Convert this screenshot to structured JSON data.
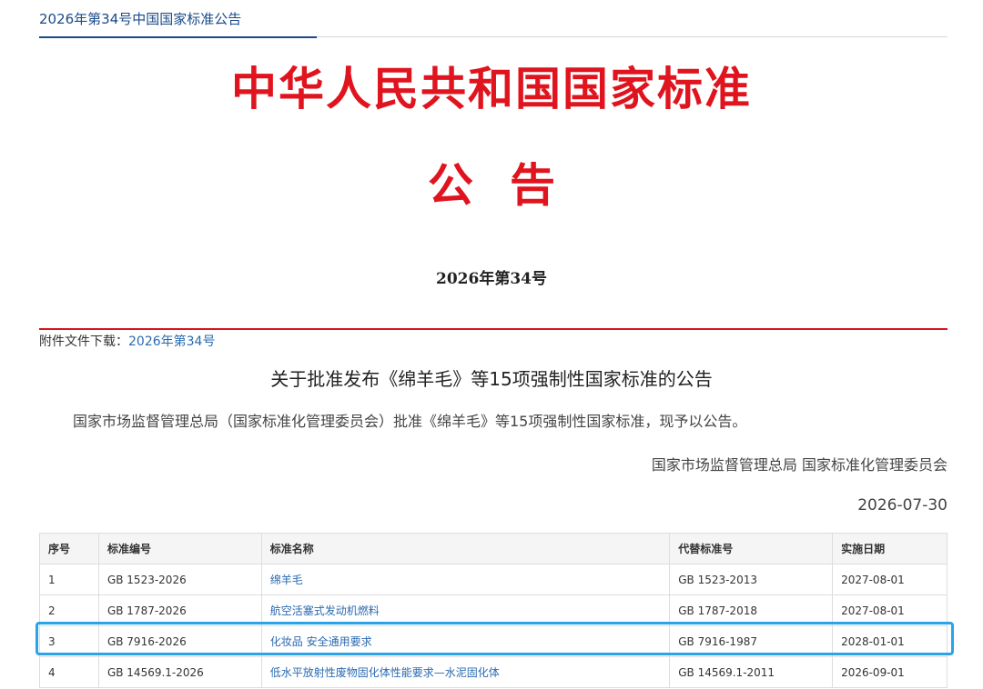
{
  "breadcrumb": "2026年第34号中国国家标准公告",
  "banner": {
    "title": "中华人民共和国国家标准",
    "subtitle": "公告",
    "issue": "2026年第34号"
  },
  "attachment": {
    "label": "附件文件下载：",
    "link": "2026年第34号"
  },
  "notice": {
    "headline": "关于批准发布《绵羊毛》等15项强制性国家标准的公告",
    "body": "国家市场监督管理总局（国家标准化管理委员会）批准《绵羊毛》等15项强制性国家标准，现予以公告。",
    "signer": "国家市场监督管理总局 国家标准化管理委员会",
    "date": "2026-07-30"
  },
  "table": {
    "headers": [
      "序号",
      "标准编号",
      "标准名称",
      "代替标准号",
      "实施日期"
    ],
    "rows": [
      [
        "1",
        "GB 1523-2026",
        "绵羊毛",
        "GB 1523-2013",
        "2027-08-01"
      ],
      [
        "2",
        "GB 1787-2026",
        "航空活塞式发动机燃料",
        "GB 1787-2018",
        "2027-08-01"
      ],
      [
        "3",
        "GB 7916-2026",
        "化妆品 安全通用要求",
        "GB 7916-1987",
        "2028-01-01"
      ],
      [
        "4",
        "GB 14569.1-2026",
        "低水平放射性废物固化体性能要求—水泥固化体",
        "GB 14569.1-2011",
        "2026-09-01"
      ]
    ]
  },
  "colors": {
    "title_red": "#e0141e",
    "link_blue": "#2a6ab0",
    "highlight": "#2aa3e8"
  }
}
